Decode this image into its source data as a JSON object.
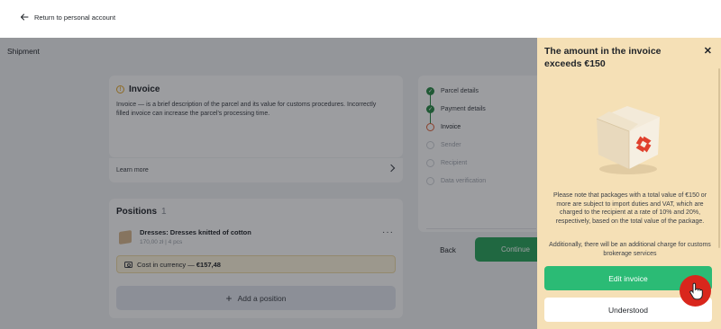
{
  "topbar": {
    "back_label": "Return to personal account",
    "back_icon": "arrow-left-icon"
  },
  "main": {
    "page_title": "Shipment"
  },
  "invoice_card": {
    "title": "Invoice",
    "description": "Invoice — is a brief description of the parcel and its value for customs procedures. Incorrectly filled invoice can increase the parcel's processing time.",
    "learn_more": "Learn more"
  },
  "positions": {
    "title": "Positions",
    "count": "1",
    "items": [
      {
        "name": "Dresses: Dresses knitted of cotton",
        "meta": "170,00 zł | 4 pcs"
      }
    ],
    "currency_label": "Cost in currency — ",
    "currency_value": "€157,48",
    "add_label": "Add a position"
  },
  "steps": {
    "items": [
      {
        "label": "Parcel details",
        "state": "done"
      },
      {
        "label": "Payment details",
        "state": "done"
      },
      {
        "label": "Invoice",
        "state": "current"
      },
      {
        "label": "Sender",
        "state": "todo"
      },
      {
        "label": "Recipient",
        "state": "todo"
      },
      {
        "label": "Data verification",
        "state": "todo"
      }
    ],
    "back_label": "Back",
    "continue_label": "Continue"
  },
  "panel": {
    "title": "The amount in the invoice exceeds €150",
    "text1": "Please note that packages with a total value of €150 or more are subject to import duties and VAT, which are charged to the recipient at a rate of 10% and 20%, respectively, based on the total value of the package.",
    "text2": "Additionally, there will be an additional charge for customs brokerage services",
    "edit_label": "Edit invoice",
    "understood_label": "Understood"
  },
  "colors": {
    "accent_green": "#2bbb75",
    "panel_bg": "#f5e0b6",
    "warning": "#e5a72a",
    "cursor_badge": "#d9261c"
  }
}
